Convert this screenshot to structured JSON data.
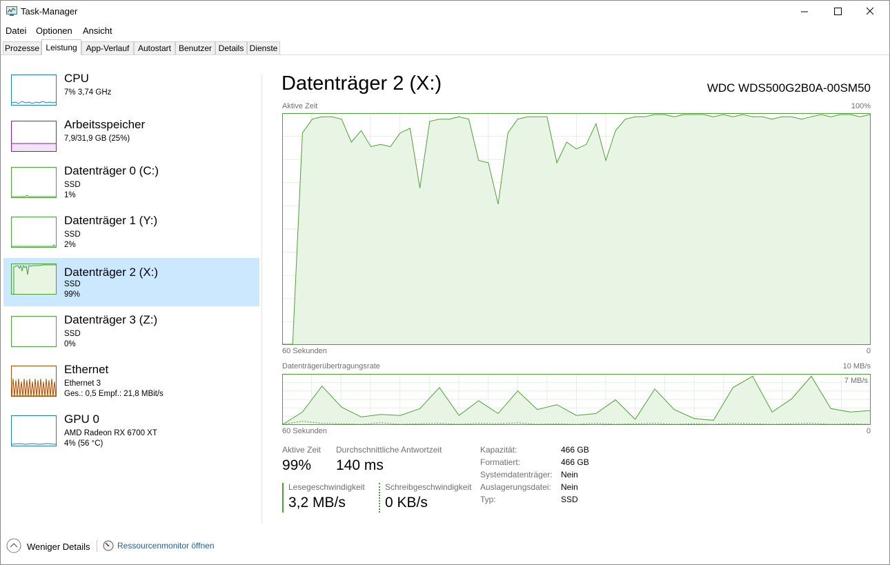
{
  "window": {
    "title": "Task-Manager"
  },
  "menu": [
    "Datei",
    "Optionen",
    "Ansicht"
  ],
  "tabs": [
    "Prozesse",
    "Leistung",
    "App-Verlauf",
    "Autostart",
    "Benutzer",
    "Details",
    "Dienste"
  ],
  "active_tab": "Leistung",
  "sidebar": {
    "items": [
      {
        "name": "CPU",
        "sub1": "7%  3,74 GHz",
        "sub2": "",
        "color": "#1a7fc7"
      },
      {
        "name": "Arbeitsspeicher",
        "sub1": "7,9/31,9 GB (25%)",
        "sub2": "",
        "color": "#8b19a6"
      },
      {
        "name": "Datenträger 0 (C:)",
        "sub1": "SSD",
        "sub2": "1%",
        "color": "#4aa134"
      },
      {
        "name": "Datenträger 1 (Y:)",
        "sub1": "SSD",
        "sub2": "2%",
        "color": "#4aa134"
      },
      {
        "name": "Datenträger 2 (X:)",
        "sub1": "SSD",
        "sub2": "99%",
        "color": "#4aa134"
      },
      {
        "name": "Datenträger 3 (Z:)",
        "sub1": "SSD",
        "sub2": "0%",
        "color": "#4aa134"
      },
      {
        "name": "Ethernet",
        "sub1": "Ethernet 3",
        "sub2": "Ges.: 0,5 Empf.: 21,8 MBit/s",
        "color": "#a74f01"
      },
      {
        "name": "GPU 0",
        "sub1": "AMD Radeon RX 6700 XT",
        "sub2": "4%  (56 °C)",
        "color": "#1a7fc7"
      }
    ],
    "selected_index": 4
  },
  "main": {
    "title": "Datenträger 2 (X:)",
    "model": "WDC  WDS500G2B0A-00SM50",
    "graph1": {
      "label": "Aktive Zeit",
      "max_label": "100%",
      "time_label": "60 Sekunden",
      "zero_label": "0"
    },
    "graph2": {
      "label": "Datenträgerübertragungsrate",
      "max_label": "10 MB/s",
      "secondary_label": "7 MB/s",
      "time_label": "60 Sekunden",
      "zero_label": "0"
    },
    "stats": {
      "active_time_label": "Aktive Zeit",
      "active_time_value": "99%",
      "response_label": "Durchschnittliche Antwortzeit",
      "response_value": "140 ms",
      "read_label": "Lesegeschwindigkeit",
      "read_value": "3,2 MB/s",
      "write_label": "Schreibgeschwindigkeit",
      "write_value": "0 KB/s"
    },
    "properties": [
      {
        "key": "Kapazität:",
        "value": "466 GB"
      },
      {
        "key": "Formatiert:",
        "value": "466 GB"
      },
      {
        "key": "Systemdatenträger:",
        "value": "Nein"
      },
      {
        "key": "Auslagerungsdatei:",
        "value": "Nein"
      },
      {
        "key": "Typ:",
        "value": "SSD"
      }
    ]
  },
  "footer": {
    "fewer_details": "Weniger Details",
    "resource_monitor": "Ressourcenmonitor öffnen"
  },
  "chart_data": [
    {
      "type": "area",
      "title": "Aktive Zeit",
      "xlabel": "60 Sekunden",
      "ylim": [
        0,
        100
      ],
      "x": [
        60,
        59,
        58,
        57,
        56,
        55,
        54,
        53,
        52,
        51,
        50,
        49,
        48,
        47,
        46,
        45,
        44,
        43,
        42,
        41,
        40,
        39,
        38,
        37,
        36,
        35,
        34,
        33,
        32,
        31,
        30,
        29,
        28,
        27,
        26,
        25,
        24,
        23,
        22,
        21,
        20,
        19,
        18,
        17,
        16,
        15,
        14,
        13,
        12,
        11,
        10,
        9,
        8,
        7,
        6,
        5,
        4,
        3,
        2,
        1,
        0
      ],
      "values": [
        0,
        0,
        92,
        98,
        99,
        99,
        98,
        88,
        93,
        86,
        87,
        86,
        92,
        94,
        68,
        97,
        98,
        98,
        99,
        98,
        80,
        79,
        61,
        92,
        98,
        99,
        99,
        99,
        79,
        88,
        85,
        87,
        96,
        80,
        93,
        98,
        99,
        99,
        100,
        100,
        99,
        100,
        100,
        100,
        99,
        100,
        99,
        100,
        99,
        99,
        98,
        99,
        99,
        98,
        99,
        100,
        99,
        100,
        100,
        99,
        100
      ]
    },
    {
      "type": "line",
      "title": "Datenträgerübertragungsrate",
      "xlabel": "60 Sekunden",
      "ylim": [
        0,
        10
      ],
      "x": [
        60,
        58,
        56,
        54,
        52,
        50,
        48,
        46,
        44,
        42,
        40,
        38,
        36,
        34,
        32,
        30,
        28,
        26,
        24,
        22,
        20,
        18,
        16,
        14,
        12,
        10,
        8,
        6,
        4,
        2,
        0
      ],
      "series": [
        {
          "values": [
            0,
            2.5,
            7.8,
            3.5,
            1.5,
            2.0,
            1.8,
            3.2,
            7.5,
            1.8,
            4.8,
            2.2,
            6.8,
            3.0,
            4.0,
            1.8,
            2.2,
            5.0,
            1.0,
            7.2,
            3.0,
            1.2,
            0.8,
            7.5,
            9.8,
            2.5,
            5.2,
            9.8,
            3.2,
            2.5,
            2.8
          ]
        },
        {
          "values": [
            0,
            0.6,
            0.2,
            0.1,
            0.0,
            0.3,
            0.0,
            0.1,
            0.2,
            0.0,
            0.2,
            0.1,
            0.3,
            0.0,
            0.1,
            0.0,
            0.2,
            0.0,
            0.1,
            0.2,
            0.0,
            0.1,
            0.0,
            0.2,
            0.1,
            0.0,
            0.1,
            0.2,
            0.0,
            0.1,
            0.0
          ]
        }
      ]
    }
  ]
}
